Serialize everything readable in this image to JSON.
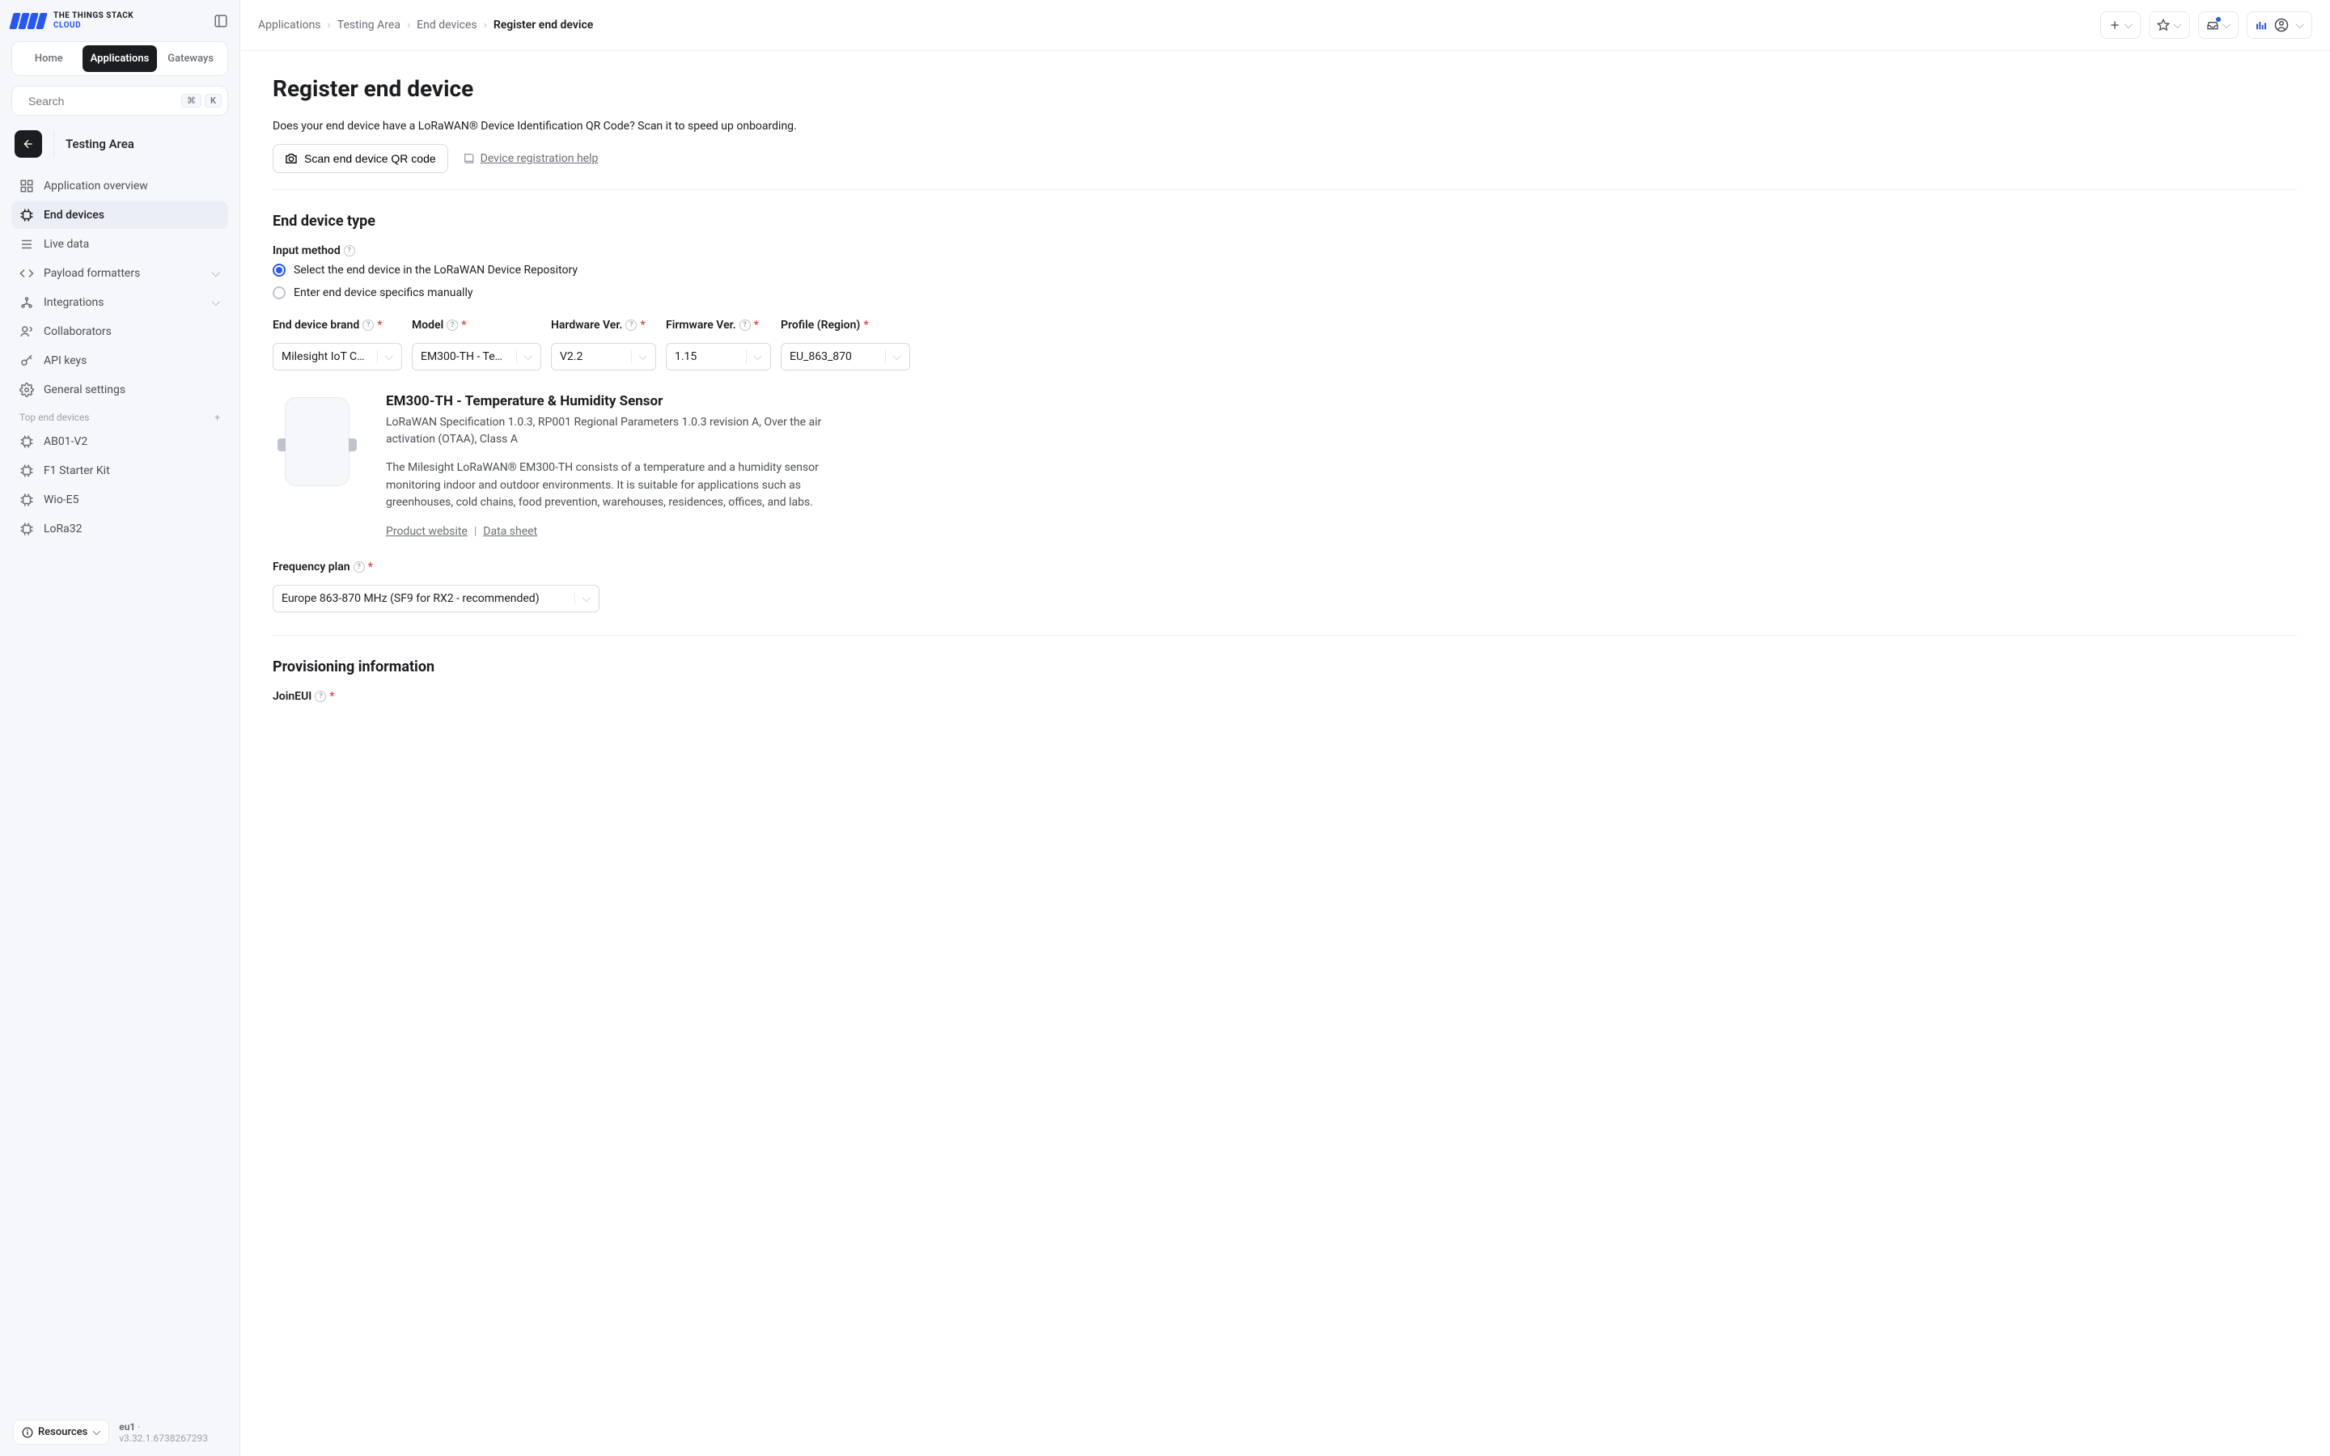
{
  "brand": {
    "line1": "THE THINGS STACK",
    "line2": "CLOUD"
  },
  "tabs": {
    "home": "Home",
    "applications": "Applications",
    "gateways": "Gateways"
  },
  "search": {
    "placeholder": "Search",
    "kbd1": "⌘",
    "kbd2": "K"
  },
  "app_context": {
    "name": "Testing Area"
  },
  "nav": {
    "overview": "Application overview",
    "end_devices": "End devices",
    "live_data": "Live data",
    "payload_formatters": "Payload formatters",
    "integrations": "Integrations",
    "collaborators": "Collaborators",
    "api_keys": "API keys",
    "general_settings": "General settings"
  },
  "top_devices": {
    "label": "Top end devices",
    "items": [
      "AB01-V2",
      "F1 Starter Kit",
      "Wio-E5",
      "LoRa32"
    ]
  },
  "footer": {
    "resources": "Resources",
    "cluster": "eu1",
    "version": "v3.32.1.6738267293"
  },
  "breadcrumb": {
    "a": "Applications",
    "b": "Testing Area",
    "c": "End devices",
    "d": "Register end device"
  },
  "page": {
    "title": "Register end device",
    "lead": "Does your end device have a LoRaWAN® Device Identification QR Code? Scan it to speed up onboarding.",
    "scan_btn": "Scan end device QR code",
    "help_link": "Device registration help"
  },
  "device_type": {
    "heading": "End device type",
    "input_method_label": "Input method",
    "radio1": "Select the end device in the LoRaWAN Device Repository",
    "radio2": "Enter end device specifics manually"
  },
  "selects": {
    "brand_label": "End device brand",
    "brand_value": "Milesight IoT Co…",
    "model_label": "Model",
    "model_value": "EM300-TH - Te…",
    "hw_label": "Hardware Ver.",
    "hw_value": "V2.2",
    "fw_label": "Firmware Ver.",
    "fw_value": "1.15",
    "profile_label": "Profile (Region)",
    "profile_value": "EU_863_870"
  },
  "device": {
    "name": "EM300-TH - Temperature & Humidity Sensor",
    "meta": "LoRaWAN Specification 1.0.3, RP001 Regional Parameters 1.0.3 revision A, Over the air activation (OTAA), Class A",
    "desc": "The Milesight LoRaWAN® EM300-TH consists of a temperature and a humidity sensor monitoring indoor and outdoor environments. It is suitable for applications such as greenhouses, cold chains, food prevention, warehouses, residences, offices, and labs.",
    "link1": "Product website",
    "link2": "Data sheet"
  },
  "freq": {
    "label": "Frequency plan",
    "value": "Europe 863-870 MHz (SF9 for RX2 - recommended)"
  },
  "provisioning": {
    "heading": "Provisioning information",
    "join_eui_label": "JoinEUI"
  }
}
